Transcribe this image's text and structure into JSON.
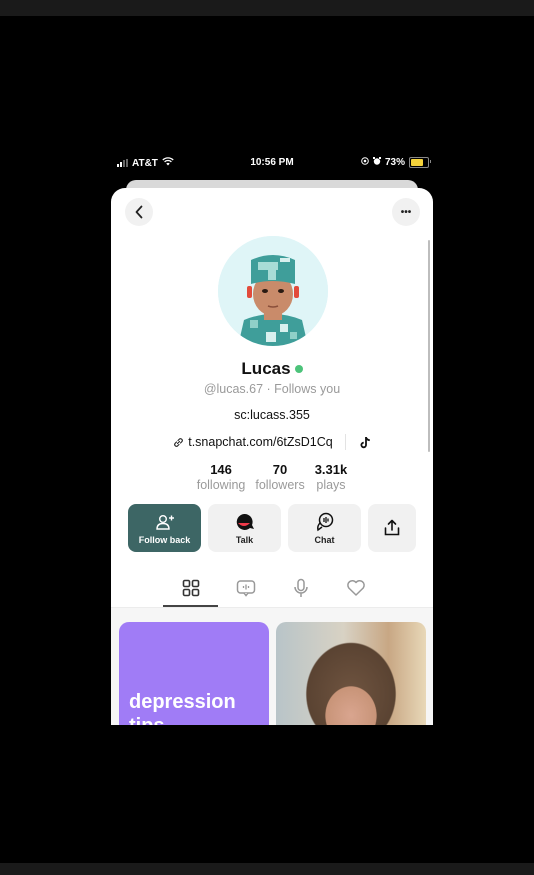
{
  "status_bar": {
    "carrier": "AT&T",
    "time": "10:56 PM",
    "battery": "73%",
    "battery_level": 0.73,
    "icons": [
      "signal-icon",
      "wifi-icon",
      "screen-lock-icon",
      "alarm-icon",
      "battery-icon"
    ]
  },
  "header": {
    "back_icon": "chevron-left-icon",
    "more_icon": "more-horizontal-icon",
    "more_label": "•••"
  },
  "profile": {
    "name": "Lucas",
    "online": true,
    "online_color": "#4cc37a",
    "handle": "@lucas.67 · Follows you",
    "bio": "sc:lucass.355",
    "link": "t.snapchat.com/6tZsD1Cq",
    "social_icon": "tiktok-icon"
  },
  "stats": [
    {
      "value": "146",
      "label": "following"
    },
    {
      "value": "70",
      "label": "followers"
    },
    {
      "value": "3.31k",
      "label": "plays"
    }
  ],
  "actions": {
    "follow_back": "Follow back",
    "talk": "Talk",
    "chat": "Chat",
    "share_icon": "share-icon",
    "primary_color": "#3d6665"
  },
  "tabs": [
    {
      "icon": "grid-icon",
      "active": true
    },
    {
      "icon": "chat-bubble-icon",
      "active": false
    },
    {
      "icon": "microphone-icon",
      "active": false
    },
    {
      "icon": "heart-icon",
      "active": false
    }
  ],
  "posts": [
    {
      "type": "text",
      "text": "depression tips",
      "color": "#a07cf6"
    },
    {
      "type": "photo"
    }
  ]
}
